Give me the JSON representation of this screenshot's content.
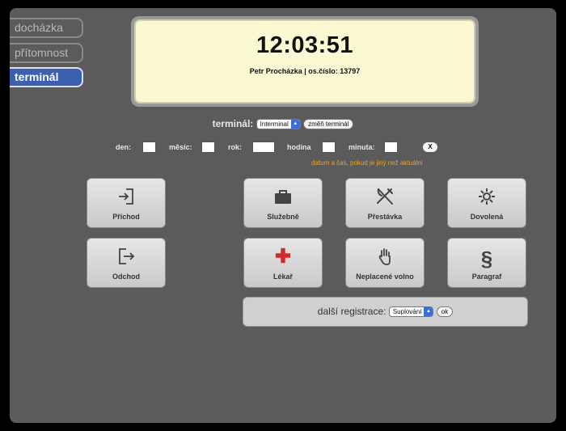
{
  "sidebar": {
    "items": [
      {
        "label": "docházka"
      },
      {
        "label": "přítomnost"
      },
      {
        "label": "terminál"
      }
    ]
  },
  "display": {
    "clock": "12:03:51",
    "user_line": "Petr Procházka | os.číslo: 13797"
  },
  "terminal": {
    "label": "terminál:",
    "selected": "Interminal",
    "change_label": "změň terminál"
  },
  "datetime": {
    "day_label": "den:",
    "month_label": "měsíc:",
    "year_label": "rok:",
    "hour_label": "hodina",
    "minute_label": "minuta:",
    "clear_label": "X",
    "hint": "datum a čas, pokud je jiný než aktuální"
  },
  "buttons": {
    "arrival": "Příchod",
    "departure": "Odchod",
    "business": "Služebně",
    "break": "Přestávka",
    "vacation": "Dovolená",
    "doctor": "Lékař",
    "unpaid": "Neplacené volno",
    "paragraph": "Paragraf"
  },
  "more": {
    "label": "další registrace:",
    "selected": "Suplování",
    "ok_label": "ok"
  },
  "colors": {
    "background": "#5b5b5b",
    "active_tab": "#3d5fb0",
    "display_bg": "#fbf8d2",
    "hint": "#f0a020",
    "doctor_cross": "#d42a2a"
  }
}
